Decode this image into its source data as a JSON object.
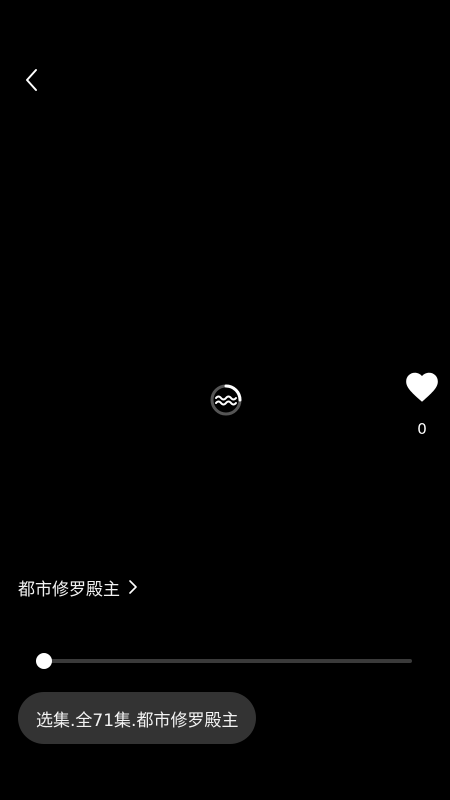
{
  "icons": {
    "back": "chevron-left-icon",
    "loading": "loading-spinner-icon",
    "like": "heart-icon",
    "series_arrow": "chevron-right-icon"
  },
  "like": {
    "count": "0"
  },
  "series": {
    "title": "都市修罗殿主"
  },
  "progress": {
    "fraction": 0.0
  },
  "episode_selector": {
    "label": "选集.全71集.都市修罗殿主"
  },
  "colors": {
    "background": "#000000",
    "text": "#ffffff",
    "pill_bg": "#333333",
    "track": "#3a3a3a"
  }
}
